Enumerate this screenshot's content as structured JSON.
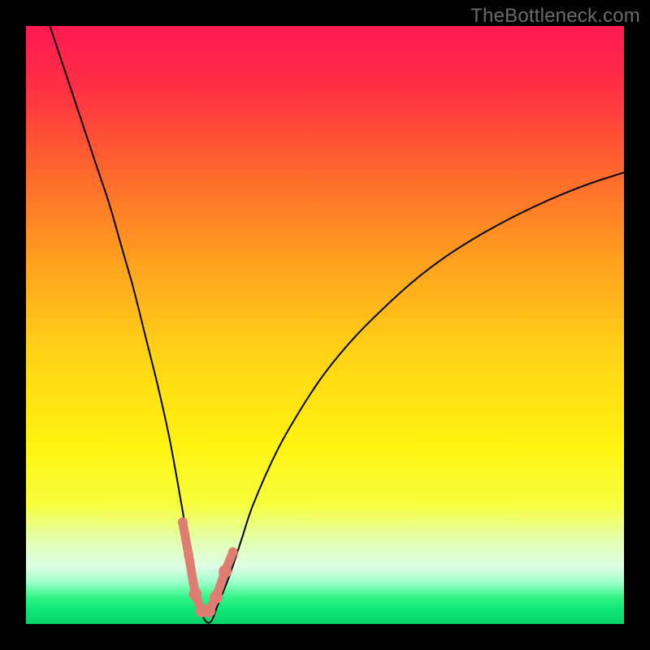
{
  "watermark": {
    "text": "TheBottleneck.com"
  },
  "chart_data": {
    "type": "line",
    "title": "",
    "xlabel": "",
    "ylabel": "",
    "xlim": [
      0,
      100
    ],
    "ylim": [
      0,
      100
    ],
    "background_gradient": {
      "stops": [
        {
          "pos": 0.0,
          "color": "#ff1a52"
        },
        {
          "pos": 0.1,
          "color": "#ff2e44"
        },
        {
          "pos": 0.25,
          "color": "#ff6a2c"
        },
        {
          "pos": 0.4,
          "color": "#ffa31f"
        },
        {
          "pos": 0.55,
          "color": "#ffd316"
        },
        {
          "pos": 0.7,
          "color": "#fff310"
        },
        {
          "pos": 0.8,
          "color": "#f7ff3d"
        },
        {
          "pos": 0.86,
          "color": "#e3ffb0"
        },
        {
          "pos": 0.905,
          "color": "#dcffe6"
        },
        {
          "pos": 0.93,
          "color": "#9fffc9"
        },
        {
          "pos": 0.955,
          "color": "#35f58a"
        },
        {
          "pos": 0.975,
          "color": "#0fe876"
        },
        {
          "pos": 1.0,
          "color": "#08d268"
        }
      ]
    },
    "series": [
      {
        "name": "bottleneck-curve",
        "color": "#000000",
        "stroke_width": 2,
        "x": [
          4,
          6,
          8,
          10,
          12,
          14,
          16,
          18,
          20,
          22,
          24,
          26,
          27,
          28,
          29,
          30,
          31,
          32,
          34,
          36,
          38,
          42,
          46,
          50,
          55,
          60,
          65,
          70,
          75,
          80,
          85,
          90,
          95,
          100
        ],
        "y": [
          100,
          94,
          88,
          82,
          76,
          70,
          63,
          56,
          48,
          40,
          31,
          20,
          14,
          8,
          3,
          0.5,
          0.5,
          3,
          8,
          14,
          20,
          29,
          36,
          42,
          48,
          53,
          57.5,
          61.3,
          64.5,
          67.3,
          69.8,
          72,
          73.9,
          75.5
        ]
      }
    ],
    "markers": {
      "name": "highlight-points",
      "color": "#df7d72",
      "radius_small": 6,
      "radius_large": 8,
      "points": [
        {
          "x": 26.2,
          "y": 17.0,
          "r": "small"
        },
        {
          "x": 27.2,
          "y": 11.5,
          "r": "small"
        },
        {
          "x": 28.3,
          "y": 5.0,
          "r": "large"
        },
        {
          "x": 29.4,
          "y": 2.2,
          "r": "large"
        },
        {
          "x": 30.6,
          "y": 2.2,
          "r": "large"
        },
        {
          "x": 31.8,
          "y": 4.5,
          "r": "large"
        },
        {
          "x": 33.3,
          "y": 8.8,
          "r": "large"
        },
        {
          "x": 34.6,
          "y": 12.0,
          "r": "small"
        }
      ],
      "connect": true
    }
  }
}
